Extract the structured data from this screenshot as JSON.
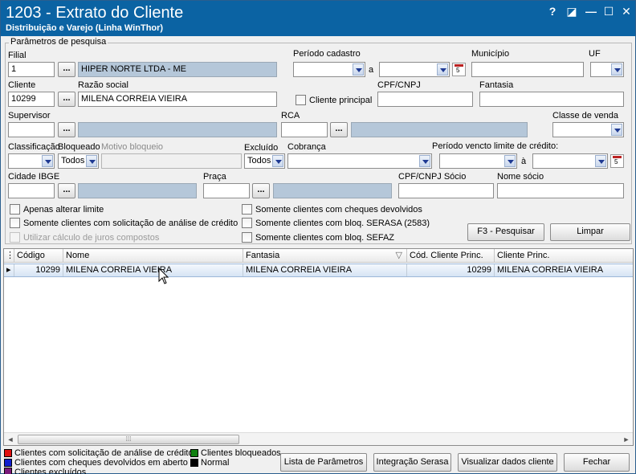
{
  "window": {
    "title": "1203 - Extrato do Cliente",
    "subtitle": "Distribuição e Varejo (Linha WinThor)",
    "controls": {
      "help": "?",
      "restore": "◪",
      "minimize": "—",
      "maximize": "☐",
      "close": "✕"
    }
  },
  "search": {
    "group_title": "Parâmetros de pesquisa",
    "filial": {
      "label": "Filial",
      "value": "1",
      "name": "HIPER NORTE LTDA - ME"
    },
    "periodo_cadastro": {
      "label": "Período cadastro",
      "sep": "a"
    },
    "municipio": {
      "label": "Município"
    },
    "uf": {
      "label": "UF"
    },
    "cliente": {
      "label": "Cliente",
      "value": "10299"
    },
    "razao_social": {
      "label": "Razão social",
      "value": "MILENA CORREIA VIEIRA"
    },
    "cliente_principal": {
      "label": "Cliente principal"
    },
    "cpf_cnpj": {
      "label": "CPF/CNPJ"
    },
    "fantasia": {
      "label": "Fantasia"
    },
    "supervisor": {
      "label": "Supervisor"
    },
    "rca": {
      "label": "RCA"
    },
    "classe_venda": {
      "label": "Classe de venda"
    },
    "classificacao": {
      "label": "Classificação"
    },
    "bloqueado": {
      "label": "Bloqueado",
      "value": "Todos"
    },
    "motivo_bloqueio": {
      "label": "Motivo bloqueio"
    },
    "excluido": {
      "label": "Excluído",
      "value": "Todos"
    },
    "cobranca": {
      "label": "Cobrança"
    },
    "periodo_vencto": {
      "label": "Período vencto limite de crédito:",
      "sep": "à"
    },
    "cidade_ibge": {
      "label": "Cidade IBGE"
    },
    "praca": {
      "label": "Praça"
    },
    "cpf_cnpj_socio": {
      "label": "CPF/CNPJ Sócio"
    },
    "nome_socio": {
      "label": "Nome sócio"
    },
    "dots": "...",
    "checks": {
      "apenas_alterar_limite": "Apenas alterar limite",
      "solicitacao_analise": "Somente clientes com solicitação de análise de crédito",
      "juros_compostos": "Utilizar cálculo de juros compostos",
      "cheques_devolvidos": "Somente clientes com cheques devolvidos",
      "bloq_serasa": "Somente clientes com bloq. SERASA (2583)",
      "bloq_sefaz": "Somente clientes com bloq. SEFAZ"
    },
    "buttons": {
      "pesquisar": "F3 - Pesquisar",
      "limpar": "Limpar"
    }
  },
  "grid": {
    "columns": [
      "Código",
      "Nome",
      "Fantasia",
      "Cód. Cliente Princ.",
      "Cliente Princ."
    ],
    "rows": [
      {
        "codigo": "10299",
        "nome": "MILENA CORREIA VIEIRA",
        "fantasia": "MILENA CORREIA VIEIRA",
        "cod_princ": "10299",
        "cliente_princ": "MILENA CORREIA VIEIRA"
      }
    ],
    "scroll_left": "◄",
    "scroll_right": "►",
    "thumb_grip": "⁞⁞⁞"
  },
  "legend": [
    {
      "label": "Clientes com solicitação de análise de crédito",
      "color": "#e01010"
    },
    {
      "label": "Clientes com cheques devolvidos em aberto",
      "color": "#1020d0"
    },
    {
      "label": "Clientes excluídos",
      "color": "#7a1a7a"
    },
    {
      "label": "Clientes bloqueados",
      "color": "#108010"
    },
    {
      "label": "Normal",
      "color": "#000000"
    }
  ],
  "footer": {
    "lista_parametros": "Lista de Parâmetros",
    "integracao_serasa": "Integração Serasa",
    "visualizar_dados": "Visualizar dados cliente",
    "fechar": "Fechar"
  }
}
